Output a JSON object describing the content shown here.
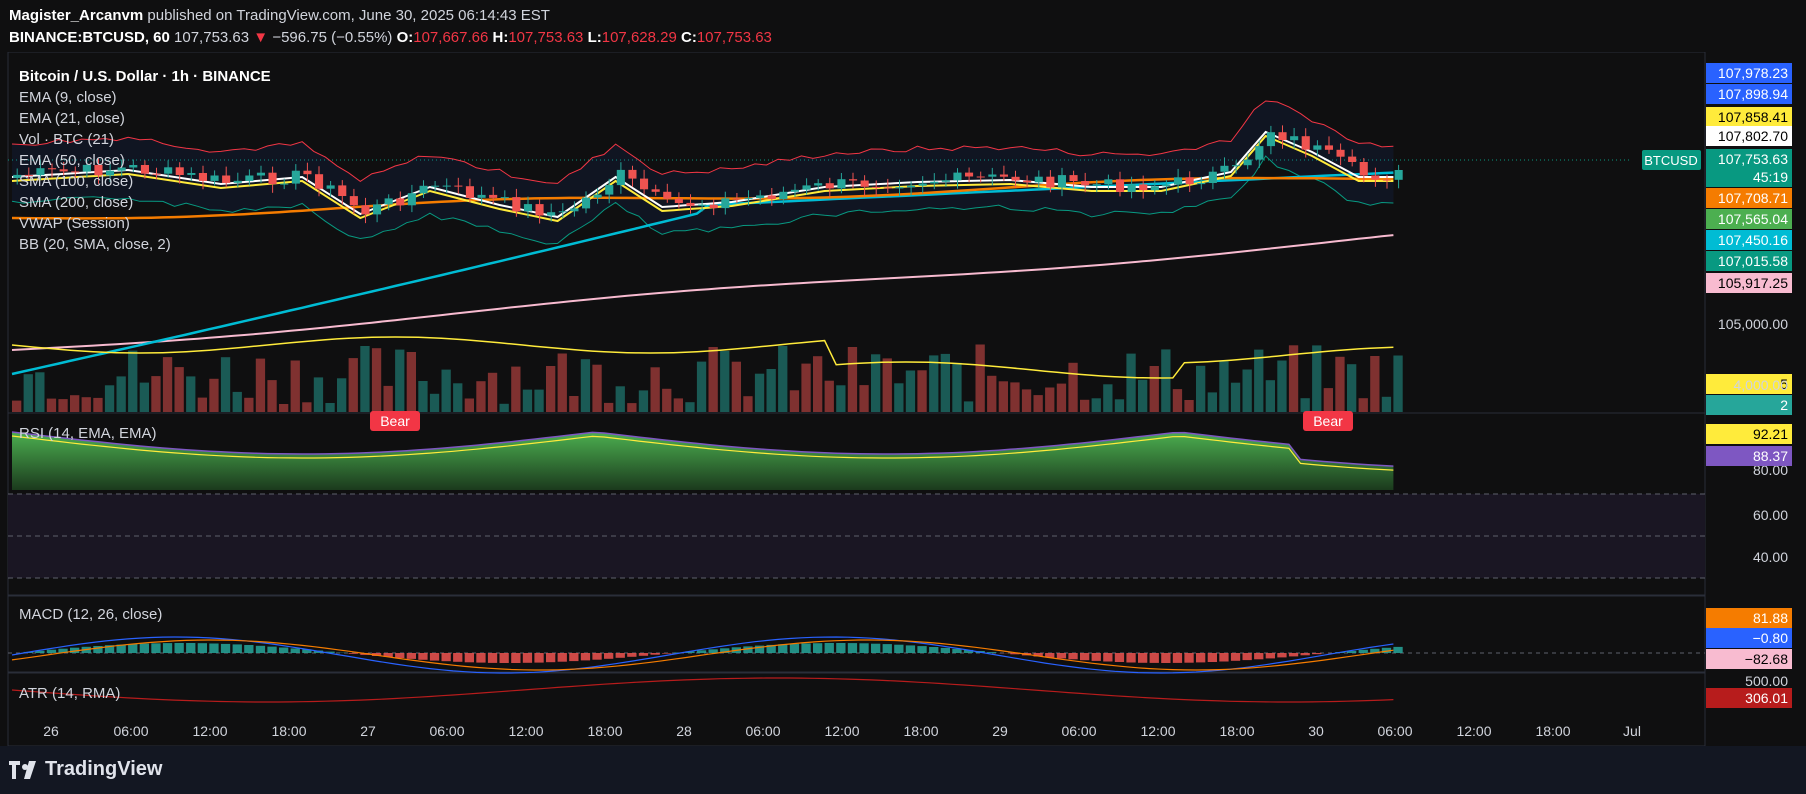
{
  "header": {
    "author": "Magister_Arcanvm",
    "published_text": "published on TradingView.com, June 30, 2025 06:14:43 EST",
    "symbol": "BINANCE:BTCUSD, 60",
    "last": "107,753.63",
    "arrow": "▼",
    "change": "−596.75 (−0.55%)",
    "o_label": "O:",
    "o_value": "107,667.66",
    "h_label": "H:",
    "h_value": "107,753.63",
    "l_label": "L:",
    "l_value": "107,628.29",
    "c_label": "C:",
    "c_value": "107,753.63"
  },
  "legend": {
    "title": "Bitcoin / U.S. Dollar · 1h · BINANCE",
    "items": [
      "EMA (9, close)",
      "EMA (21, close)",
      "Vol · BTC (21)",
      "EMA (50, close)",
      "SMA (100, close)",
      "SMA (200, close)",
      "VWAP (Session)",
      "BB (20, SMA, close, 2)"
    ]
  },
  "panes": {
    "rsi_label": "RSI (14, EMA, EMA)",
    "macd_label": "MACD (12, 26, close)",
    "atr_label": "ATR (14, RMA)"
  },
  "footer": {
    "brand": "TradingView"
  },
  "chart_data": {
    "type": "line",
    "x_labels": [
      "26",
      "06:00",
      "12:00",
      "18:00",
      "27",
      "06:00",
      "12:00",
      "18:00",
      "28",
      "06:00",
      "12:00",
      "18:00",
      "29",
      "06:00",
      "12:00",
      "18:00",
      "30",
      "06:00",
      "12:00",
      "18:00",
      "Jul"
    ],
    "price_axis_ticks": [
      "105,000.00",
      "4,000.00"
    ],
    "rsi_axis_ticks": [
      "80.00",
      "60.00",
      "40.00"
    ],
    "macd_axis_ticks": [
      "500.00"
    ],
    "price_tags": [
      {
        "value": "107,978.23",
        "color": "#2962ff",
        "text_color": "#ffffff"
      },
      {
        "value": "107,898.94",
        "color": "#2962ff",
        "text_color": "#ffffff"
      },
      {
        "value": "107,858.41",
        "color": "#ffeb3b",
        "text_color": "#000000"
      },
      {
        "value": "107,802.70",
        "color": "#ffffff",
        "text_color": "#000000"
      },
      {
        "value": "107,753.63",
        "color": "#089981",
        "text_color": "#ffffff"
      },
      {
        "value": "45:19",
        "color": "#089981",
        "text_color": "#ffffff"
      },
      {
        "value": "107,708.71",
        "color": "#f57c00",
        "text_color": "#ffffff"
      },
      {
        "value": "107,565.04",
        "color": "#4caf50",
        "text_color": "#ffffff"
      },
      {
        "value": "107,450.16",
        "color": "#00bcd4",
        "text_color": "#ffffff"
      },
      {
        "value": "107,015.58",
        "color": "#089981",
        "text_color": "#ffffff"
      },
      {
        "value": "105,917.25",
        "color": "#f8bbd0",
        "text_color": "#000000"
      },
      {
        "value": "5",
        "color": "#ffeb3b",
        "text_color": "#000000"
      },
      {
        "value": "2",
        "color": "#26a69a",
        "text_color": "#ffffff"
      }
    ],
    "symbol_tag": "BTCUSD",
    "rsi_tags": [
      {
        "value": "92.21",
        "color": "#ffeb3b",
        "text_color": "#000000"
      },
      {
        "value": "88.37",
        "color": "#7e57c2",
        "text_color": "#ffffff"
      }
    ],
    "macd_tags": [
      {
        "value": "81.88",
        "color": "#f57c00",
        "text_color": "#ffffff"
      },
      {
        "value": "−0.80",
        "color": "#2962ff",
        "text_color": "#ffffff"
      },
      {
        "value": "−82.68",
        "color": "#f8bbd0",
        "text_color": "#000000"
      }
    ],
    "atr_tags": [
      {
        "value": "306.01",
        "color": "#b71c1c",
        "text_color": "#ffffff"
      }
    ],
    "bear_label": "Bear",
    "colors": {
      "up": "#26a69a",
      "down": "#ef5350",
      "bg": "#0f0f10"
    }
  }
}
